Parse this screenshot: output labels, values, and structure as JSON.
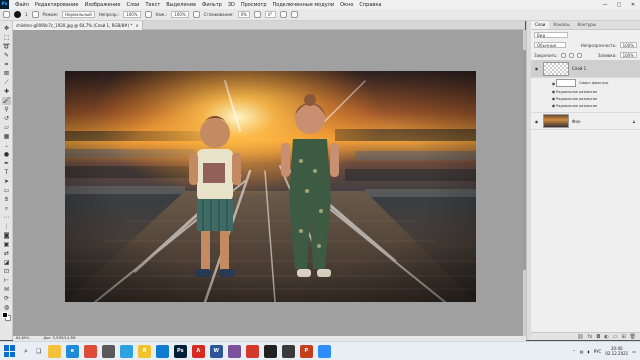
{
  "menu": {
    "app_icon": "Ps",
    "items": [
      "Файл",
      "Редактирование",
      "Изображение",
      "Слои",
      "Текст",
      "Выделение",
      "Фильтр",
      "3D",
      "Просмотр",
      "Подключенные модули",
      "Окно",
      "Справка"
    ],
    "window_controls": [
      "—",
      "□",
      "✕"
    ]
  },
  "options": {
    "brush_size": "1",
    "mode_label": "Режим:",
    "mode_value": "Нормальный",
    "opacity_label": "Непрозр.:",
    "opacity_value": "100%",
    "pressure_label": "Наж.:",
    "pressure_value": "100%",
    "smoothing_label": "Сглаживание:",
    "smoothing_value": "0%",
    "angle_value": "0°"
  },
  "document": {
    "tab_title": "children-g0090c7c_1920.jpg @ 64,7% (Слой 1, RGB/8#) *",
    "close": "×"
  },
  "status": {
    "zoom": "64,69%",
    "doc_size": "Док: 5,93M/14,3M"
  },
  "panel": {
    "tabs": [
      "Слои",
      "Каналы",
      "Контуры"
    ],
    "filter_label": "Вид",
    "blend_mode": "Обычные",
    "opacity_label": "Непрозрачность:",
    "opacity_value": "100%",
    "lock_label": "Закрепить:",
    "fill_label": "Заливка:",
    "fill_value": "100%",
    "layers": [
      {
        "name": "Слой 1",
        "selected": true
      },
      {
        "name": "Фон",
        "selected": false
      }
    ],
    "effects_header": "Эффекты",
    "effects_title": "Смарт-фильтры",
    "effects": [
      "Радиальное размытие",
      "Радиальное размытие",
      "Радиальное размытие"
    ],
    "bottom_icons": [
      "link-icon",
      "fx-icon",
      "mask-icon",
      "adjustment-icon",
      "folder-icon",
      "new-layer-icon",
      "trash-icon"
    ]
  },
  "taskbar": {
    "apps": [
      {
        "name": "explorer-icon",
        "color": "#f3c13a",
        "label": ""
      },
      {
        "name": "edge-icon",
        "color": "#1f8ad6",
        "label": "e"
      },
      {
        "name": "chrome-icon",
        "color": "#dd4b39",
        "label": ""
      },
      {
        "name": "store-icon",
        "color": "#5a5a5a",
        "label": ""
      },
      {
        "name": "telegram-icon",
        "color": "#2aa3e0",
        "label": ""
      },
      {
        "name": "yandex-icon",
        "color": "#f2c12e",
        "label": "Я"
      },
      {
        "name": "photos-icon",
        "color": "#0f7bd1",
        "label": ""
      },
      {
        "name": "photoshop-icon",
        "color": "#001e36",
        "label": "Ps"
      },
      {
        "name": "acrobat-icon",
        "color": "#d72a20",
        "label": "A"
      },
      {
        "name": "word-icon",
        "color": "#2b579a",
        "label": "W"
      },
      {
        "name": "viber-icon",
        "color": "#7b519d",
        "label": ""
      },
      {
        "name": "media-icon",
        "color": "#d33a2c",
        "label": ""
      },
      {
        "name": "screen-recorder-icon",
        "color": "#222222",
        "label": ""
      },
      {
        "name": "camera-icon",
        "color": "#3a3a3a",
        "label": ""
      },
      {
        "name": "powerpoint-icon",
        "color": "#c43e1c",
        "label": "P"
      },
      {
        "name": "zoom-icon",
        "color": "#2d8cff",
        "label": ""
      }
    ],
    "language": "РУС",
    "time": "20:40",
    "date": "02.12.2021"
  }
}
